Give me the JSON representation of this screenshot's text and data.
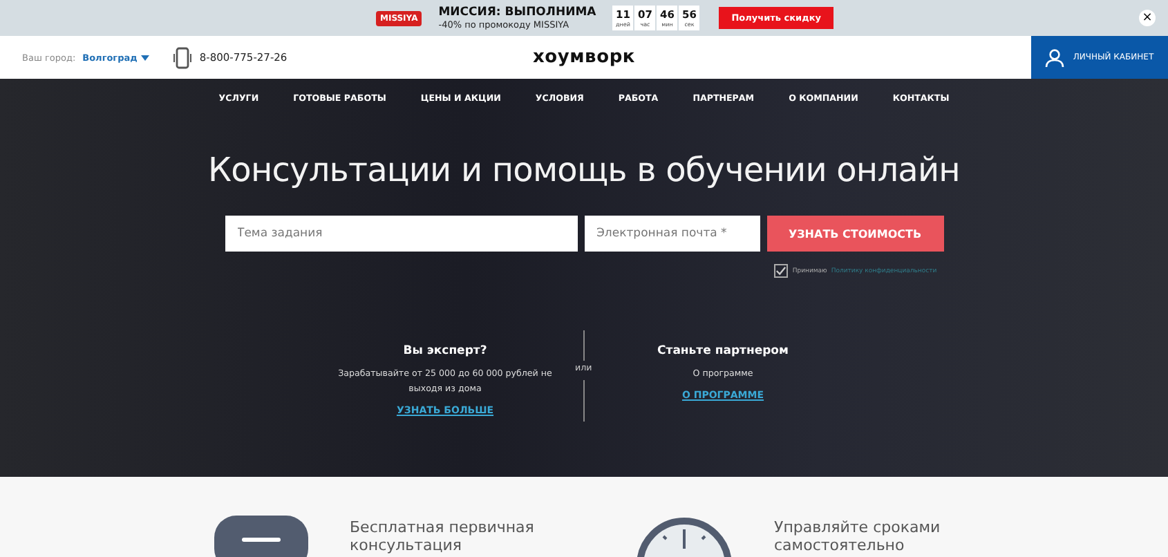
{
  "promo": {
    "title": "МИССИЯ: ВЫПОЛНИМА",
    "badge": "MISSIYA",
    "subtitle": "-40% по промокоду MISSIYA",
    "countdown": [
      {
        "value": "11",
        "unit": "дней"
      },
      {
        "value": "07",
        "unit": "час"
      },
      {
        "value": "46",
        "unit": "мин"
      },
      {
        "value": "56",
        "unit": "сек"
      }
    ],
    "button": "Получить скидку",
    "close": "×"
  },
  "header": {
    "city_label": "Ваш город:",
    "city": "Волгоград",
    "phone": "8-800-775-27-26",
    "logo": "хоумворк",
    "account": "ЛИЧНЫЙ КАБИНЕТ"
  },
  "nav": [
    "УСЛУГИ",
    "ГОТОВЫЕ РАБОТЫ",
    "ЦЕНЫ И АКЦИИ",
    "УСЛОВИЯ",
    "РАБОТА",
    "ПАРТНЕРАМ",
    "О КОМПАНИИ",
    "КОНТАКТЫ"
  ],
  "hero": {
    "title": "Консультации и помощь в обучении онлайн",
    "topic_placeholder": "Тема задания",
    "email_placeholder": "Электронная почта *",
    "submit": "УЗНАТЬ СТОИМОСТЬ",
    "consent_checked": true,
    "consent_text": "Принимаю",
    "consent_link": "Политику конфиденциальности"
  },
  "offers": {
    "left": {
      "title": "Вы эксперт?",
      "text": "Зарабатывайте от 25 000 до 60 000 рублей не выходя из дома",
      "link": "УЗНАТЬ БОЛЬШЕ"
    },
    "separator": "или",
    "right": {
      "title": "Станьте партнером",
      "text": "О программе",
      "link": "О ПРОГРАММЕ"
    }
  },
  "features": [
    {
      "kind": "chat",
      "text": "Бесплатная первичная консультация"
    },
    {
      "kind": "clock",
      "text": "Управляйте сроками самостоятельно"
    }
  ]
}
